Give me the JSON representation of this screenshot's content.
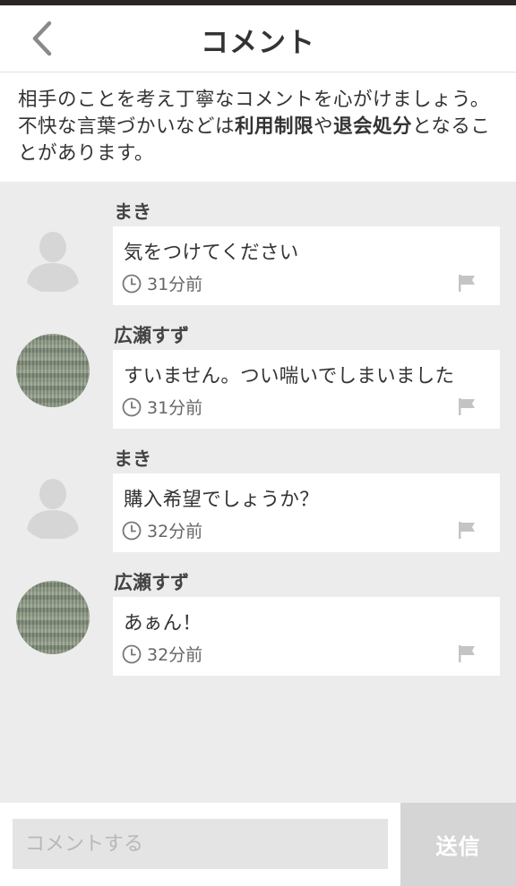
{
  "header": {
    "title": "コメント",
    "back_icon": "chevron-left-icon"
  },
  "notice": {
    "part1": "相手のことを考え丁寧なコメントを心がけましょう。不快な言葉づかいなどは",
    "bold1": "利用制限",
    "part2": "や",
    "bold2": "退会処分",
    "part3": "となることがあります。"
  },
  "comments": [
    {
      "user": "まき",
      "avatar": "default-user-icon",
      "text": "気をつけてください",
      "time": "31分前"
    },
    {
      "user": "広瀬すず",
      "avatar": "user-photo",
      "text": "すいません。つい喘いでしまいました",
      "time": "31分前"
    },
    {
      "user": "まき",
      "avatar": "default-user-icon",
      "text": "購入希望でしょうか？",
      "time": "32分前"
    },
    {
      "user": "広瀬すず",
      "avatar": "user-photo",
      "text": "あぁん！",
      "time": "32分前"
    }
  ],
  "footer": {
    "input_placeholder": "コメントする",
    "input_value": "",
    "send_label": "送信"
  },
  "colors": {
    "background": "#ececec",
    "send_button": "#d5d5d5",
    "input_background": "#e4e4e4"
  }
}
